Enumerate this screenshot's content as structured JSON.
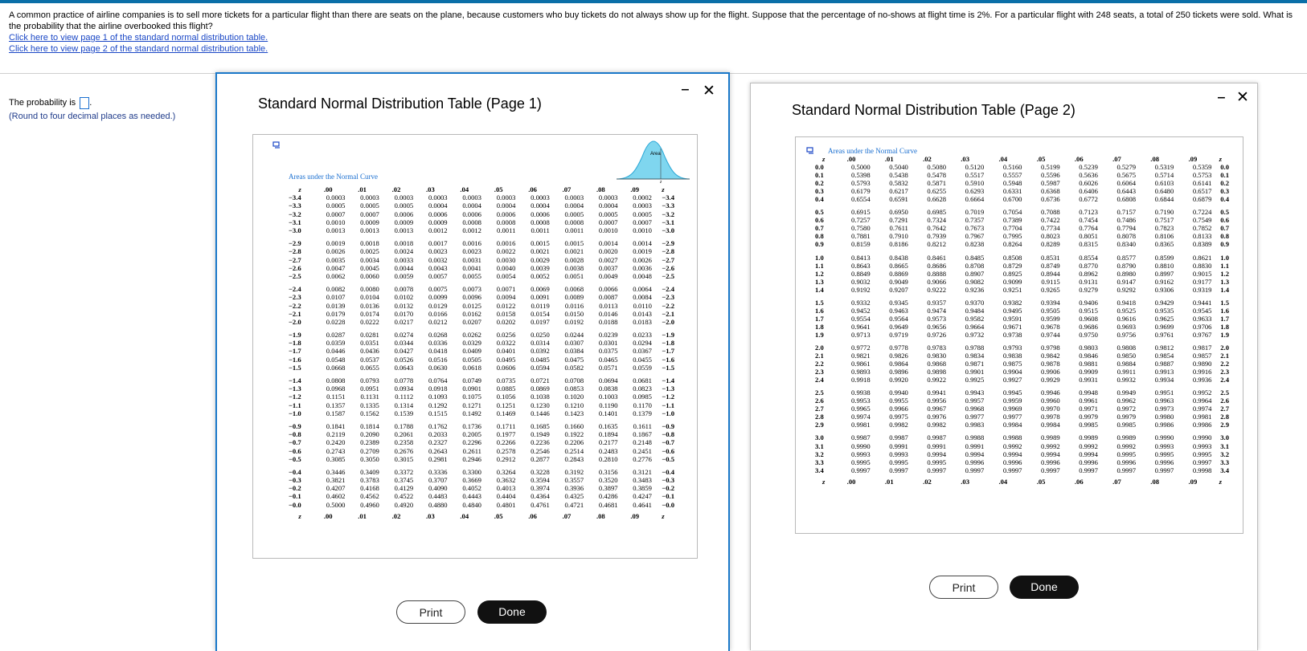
{
  "question": {
    "text": "A common practice of airline companies is to sell more tickets for a particular flight than there are seats on the plane, because customers who buy tickets do not always show up for the flight. Suppose that the percentage of no-shows at flight time is 2%. For a particular flight with 248 seats, a total of 250 tickets were sold. What is the probability that the airline overbooked this flight?",
    "link1": "Click here to view page 1 of the standard normal distribution table.",
    "link2": "Click here to view page 2 of the standard normal distribution table."
  },
  "answer": {
    "prefix": "The probability is",
    "suffix": ".",
    "note": "(Round to four decimal places as needed.)",
    "value": ""
  },
  "modal1": {
    "title": "Standard Normal Distribution Table (Page 1)",
    "minimize": "‒",
    "close": "✕",
    "curve_label": "Areas under the Normal Curve",
    "area_label": "Area",
    "print": "Print",
    "done": "Done",
    "header": [
      "z",
      ".00",
      ".01",
      ".02",
      ".03",
      ".04",
      ".05",
      ".06",
      ".07",
      ".08",
      ".09",
      "z"
    ],
    "rows": [
      [
        "−3.4",
        "0.0003",
        "0.0003",
        "0.0003",
        "0.0003",
        "0.0003",
        "0.0003",
        "0.0003",
        "0.0003",
        "0.0003",
        "0.0002",
        "−3.4"
      ],
      [
        "−3.3",
        "0.0005",
        "0.0005",
        "0.0005",
        "0.0004",
        "0.0004",
        "0.0004",
        "0.0004",
        "0.0004",
        "0.0004",
        "0.0003",
        "−3.3"
      ],
      [
        "−3.2",
        "0.0007",
        "0.0007",
        "0.0006",
        "0.0006",
        "0.0006",
        "0.0006",
        "0.0006",
        "0.0005",
        "0.0005",
        "0.0005",
        "−3.2"
      ],
      [
        "−3.1",
        "0.0010",
        "0.0009",
        "0.0009",
        "0.0009",
        "0.0008",
        "0.0008",
        "0.0008",
        "0.0008",
        "0.0007",
        "0.0007",
        "−3.1"
      ],
      [
        "−3.0",
        "0.0013",
        "0.0013",
        "0.0013",
        "0.0012",
        "0.0012",
        "0.0011",
        "0.0011",
        "0.0011",
        "0.0010",
        "0.0010",
        "−3.0"
      ],
      [
        "−2.9",
        "0.0019",
        "0.0018",
        "0.0018",
        "0.0017",
        "0.0016",
        "0.0016",
        "0.0015",
        "0.0015",
        "0.0014",
        "0.0014",
        "−2.9"
      ],
      [
        "−2.8",
        "0.0026",
        "0.0025",
        "0.0024",
        "0.0023",
        "0.0023",
        "0.0022",
        "0.0021",
        "0.0021",
        "0.0020",
        "0.0019",
        "−2.8"
      ],
      [
        "−2.7",
        "0.0035",
        "0.0034",
        "0.0033",
        "0.0032",
        "0.0031",
        "0.0030",
        "0.0029",
        "0.0028",
        "0.0027",
        "0.0026",
        "−2.7"
      ],
      [
        "−2.6",
        "0.0047",
        "0.0045",
        "0.0044",
        "0.0043",
        "0.0041",
        "0.0040",
        "0.0039",
        "0.0038",
        "0.0037",
        "0.0036",
        "−2.6"
      ],
      [
        "−2.5",
        "0.0062",
        "0.0060",
        "0.0059",
        "0.0057",
        "0.0055",
        "0.0054",
        "0.0052",
        "0.0051",
        "0.0049",
        "0.0048",
        "−2.5"
      ],
      [
        "−2.4",
        "0.0082",
        "0.0080",
        "0.0078",
        "0.0075",
        "0.0073",
        "0.0071",
        "0.0069",
        "0.0068",
        "0.0066",
        "0.0064",
        "−2.4"
      ],
      [
        "−2.3",
        "0.0107",
        "0.0104",
        "0.0102",
        "0.0099",
        "0.0096",
        "0.0094",
        "0.0091",
        "0.0089",
        "0.0087",
        "0.0084",
        "−2.3"
      ],
      [
        "−2.2",
        "0.0139",
        "0.0136",
        "0.0132",
        "0.0129",
        "0.0125",
        "0.0122",
        "0.0119",
        "0.0116",
        "0.0113",
        "0.0110",
        "−2.2"
      ],
      [
        "−2.1",
        "0.0179",
        "0.0174",
        "0.0170",
        "0.0166",
        "0.0162",
        "0.0158",
        "0.0154",
        "0.0150",
        "0.0146",
        "0.0143",
        "−2.1"
      ],
      [
        "−2.0",
        "0.0228",
        "0.0222",
        "0.0217",
        "0.0212",
        "0.0207",
        "0.0202",
        "0.0197",
        "0.0192",
        "0.0188",
        "0.0183",
        "−2.0"
      ],
      [
        "−1.9",
        "0.0287",
        "0.0281",
        "0.0274",
        "0.0268",
        "0.0262",
        "0.0256",
        "0.0250",
        "0.0244",
        "0.0239",
        "0.0233",
        "−1.9"
      ],
      [
        "−1.8",
        "0.0359",
        "0.0351",
        "0.0344",
        "0.0336",
        "0.0329",
        "0.0322",
        "0.0314",
        "0.0307",
        "0.0301",
        "0.0294",
        "−1.8"
      ],
      [
        "−1.7",
        "0.0446",
        "0.0436",
        "0.0427",
        "0.0418",
        "0.0409",
        "0.0401",
        "0.0392",
        "0.0384",
        "0.0375",
        "0.0367",
        "−1.7"
      ],
      [
        "−1.6",
        "0.0548",
        "0.0537",
        "0.0526",
        "0.0516",
        "0.0505",
        "0.0495",
        "0.0485",
        "0.0475",
        "0.0465",
        "0.0455",
        "−1.6"
      ],
      [
        "−1.5",
        "0.0668",
        "0.0655",
        "0.0643",
        "0.0630",
        "0.0618",
        "0.0606",
        "0.0594",
        "0.0582",
        "0.0571",
        "0.0559",
        "−1.5"
      ],
      [
        "−1.4",
        "0.0808",
        "0.0793",
        "0.0778",
        "0.0764",
        "0.0749",
        "0.0735",
        "0.0721",
        "0.0708",
        "0.0694",
        "0.0681",
        "−1.4"
      ],
      [
        "−1.3",
        "0.0968",
        "0.0951",
        "0.0934",
        "0.0918",
        "0.0901",
        "0.0885",
        "0.0869",
        "0.0853",
        "0.0838",
        "0.0823",
        "−1.3"
      ],
      [
        "−1.2",
        "0.1151",
        "0.1131",
        "0.1112",
        "0.1093",
        "0.1075",
        "0.1056",
        "0.1038",
        "0.1020",
        "0.1003",
        "0.0985",
        "−1.2"
      ],
      [
        "−1.1",
        "0.1357",
        "0.1335",
        "0.1314",
        "0.1292",
        "0.1271",
        "0.1251",
        "0.1230",
        "0.1210",
        "0.1190",
        "0.1170",
        "−1.1"
      ],
      [
        "−1.0",
        "0.1587",
        "0.1562",
        "0.1539",
        "0.1515",
        "0.1492",
        "0.1469",
        "0.1446",
        "0.1423",
        "0.1401",
        "0.1379",
        "−1.0"
      ],
      [
        "−0.9",
        "0.1841",
        "0.1814",
        "0.1788",
        "0.1762",
        "0.1736",
        "0.1711",
        "0.1685",
        "0.1660",
        "0.1635",
        "0.1611",
        "−0.9"
      ],
      [
        "−0.8",
        "0.2119",
        "0.2090",
        "0.2061",
        "0.2033",
        "0.2005",
        "0.1977",
        "0.1949",
        "0.1922",
        "0.1894",
        "0.1867",
        "−0.8"
      ],
      [
        "−0.7",
        "0.2420",
        "0.2389",
        "0.2358",
        "0.2327",
        "0.2296",
        "0.2266",
        "0.2236",
        "0.2206",
        "0.2177",
        "0.2148",
        "−0.7"
      ],
      [
        "−0.6",
        "0.2743",
        "0.2709",
        "0.2676",
        "0.2643",
        "0.2611",
        "0.2578",
        "0.2546",
        "0.2514",
        "0.2483",
        "0.2451",
        "−0.6"
      ],
      [
        "−0.5",
        "0.3085",
        "0.3050",
        "0.3015",
        "0.2981",
        "0.2946",
        "0.2912",
        "0.2877",
        "0.2843",
        "0.2810",
        "0.2776",
        "−0.5"
      ],
      [
        "−0.4",
        "0.3446",
        "0.3409",
        "0.3372",
        "0.3336",
        "0.3300",
        "0.3264",
        "0.3228",
        "0.3192",
        "0.3156",
        "0.3121",
        "−0.4"
      ],
      [
        "−0.3",
        "0.3821",
        "0.3783",
        "0.3745",
        "0.3707",
        "0.3669",
        "0.3632",
        "0.3594",
        "0.3557",
        "0.3520",
        "0.3483",
        "−0.3"
      ],
      [
        "−0.2",
        "0.4207",
        "0.4168",
        "0.4129",
        "0.4090",
        "0.4052",
        "0.4013",
        "0.3974",
        "0.3936",
        "0.3897",
        "0.3859",
        "−0.2"
      ],
      [
        "−0.1",
        "0.4602",
        "0.4562",
        "0.4522",
        "0.4483",
        "0.4443",
        "0.4404",
        "0.4364",
        "0.4325",
        "0.4286",
        "0.4247",
        "−0.1"
      ],
      [
        "−0.0",
        "0.5000",
        "0.4960",
        "0.4920",
        "0.4880",
        "0.4840",
        "0.4801",
        "0.4761",
        "0.4721",
        "0.4681",
        "0.4641",
        "−0.0"
      ]
    ]
  },
  "modal2": {
    "title": "Standard Normal Distribution Table (Page 2)",
    "minimize": "‒",
    "close": "✕",
    "curve_label": "Areas under the Normal Curve",
    "print": "Print",
    "done": "Done",
    "header": [
      "z",
      ".00",
      ".01",
      ".02",
      ".03",
      ".04",
      ".05",
      ".06",
      ".07",
      ".08",
      ".09",
      "z"
    ],
    "rows": [
      [
        "0.0",
        "0.5000",
        "0.5040",
        "0.5080",
        "0.5120",
        "0.5160",
        "0.5199",
        "0.5239",
        "0.5279",
        "0.5319",
        "0.5359",
        "0.0"
      ],
      [
        "0.1",
        "0.5398",
        "0.5438",
        "0.5478",
        "0.5517",
        "0.5557",
        "0.5596",
        "0.5636",
        "0.5675",
        "0.5714",
        "0.5753",
        "0.1"
      ],
      [
        "0.2",
        "0.5793",
        "0.5832",
        "0.5871",
        "0.5910",
        "0.5948",
        "0.5987",
        "0.6026",
        "0.6064",
        "0.6103",
        "0.6141",
        "0.2"
      ],
      [
        "0.3",
        "0.6179",
        "0.6217",
        "0.6255",
        "0.6293",
        "0.6331",
        "0.6368",
        "0.6406",
        "0.6443",
        "0.6480",
        "0.6517",
        "0.3"
      ],
      [
        "0.4",
        "0.6554",
        "0.6591",
        "0.6628",
        "0.6664",
        "0.6700",
        "0.6736",
        "0.6772",
        "0.6808",
        "0.6844",
        "0.6879",
        "0.4"
      ],
      [
        "0.5",
        "0.6915",
        "0.6950",
        "0.6985",
        "0.7019",
        "0.7054",
        "0.7088",
        "0.7123",
        "0.7157",
        "0.7190",
        "0.7224",
        "0.5"
      ],
      [
        "0.6",
        "0.7257",
        "0.7291",
        "0.7324",
        "0.7357",
        "0.7389",
        "0.7422",
        "0.7454",
        "0.7486",
        "0.7517",
        "0.7549",
        "0.6"
      ],
      [
        "0.7",
        "0.7580",
        "0.7611",
        "0.7642",
        "0.7673",
        "0.7704",
        "0.7734",
        "0.7764",
        "0.7794",
        "0.7823",
        "0.7852",
        "0.7"
      ],
      [
        "0.8",
        "0.7881",
        "0.7910",
        "0.7939",
        "0.7967",
        "0.7995",
        "0.8023",
        "0.8051",
        "0.8078",
        "0.8106",
        "0.8133",
        "0.8"
      ],
      [
        "0.9",
        "0.8159",
        "0.8186",
        "0.8212",
        "0.8238",
        "0.8264",
        "0.8289",
        "0.8315",
        "0.8340",
        "0.8365",
        "0.8389",
        "0.9"
      ],
      [
        "1.0",
        "0.8413",
        "0.8438",
        "0.8461",
        "0.8485",
        "0.8508",
        "0.8531",
        "0.8554",
        "0.8577",
        "0.8599",
        "0.8621",
        "1.0"
      ],
      [
        "1.1",
        "0.8643",
        "0.8665",
        "0.8686",
        "0.8708",
        "0.8729",
        "0.8749",
        "0.8770",
        "0.8790",
        "0.8810",
        "0.8830",
        "1.1"
      ],
      [
        "1.2",
        "0.8849",
        "0.8869",
        "0.8888",
        "0.8907",
        "0.8925",
        "0.8944",
        "0.8962",
        "0.8980",
        "0.8997",
        "0.9015",
        "1.2"
      ],
      [
        "1.3",
        "0.9032",
        "0.9049",
        "0.9066",
        "0.9082",
        "0.9099",
        "0.9115",
        "0.9131",
        "0.9147",
        "0.9162",
        "0.9177",
        "1.3"
      ],
      [
        "1.4",
        "0.9192",
        "0.9207",
        "0.9222",
        "0.9236",
        "0.9251",
        "0.9265",
        "0.9279",
        "0.9292",
        "0.9306",
        "0.9319",
        "1.4"
      ],
      [
        "1.5",
        "0.9332",
        "0.9345",
        "0.9357",
        "0.9370",
        "0.9382",
        "0.9394",
        "0.9406",
        "0.9418",
        "0.9429",
        "0.9441",
        "1.5"
      ],
      [
        "1.6",
        "0.9452",
        "0.9463",
        "0.9474",
        "0.9484",
        "0.9495",
        "0.9505",
        "0.9515",
        "0.9525",
        "0.9535",
        "0.9545",
        "1.6"
      ],
      [
        "1.7",
        "0.9554",
        "0.9564",
        "0.9573",
        "0.9582",
        "0.9591",
        "0.9599",
        "0.9608",
        "0.9616",
        "0.9625",
        "0.9633",
        "1.7"
      ],
      [
        "1.8",
        "0.9641",
        "0.9649",
        "0.9656",
        "0.9664",
        "0.9671",
        "0.9678",
        "0.9686",
        "0.9693",
        "0.9699",
        "0.9706",
        "1.8"
      ],
      [
        "1.9",
        "0.9713",
        "0.9719",
        "0.9726",
        "0.9732",
        "0.9738",
        "0.9744",
        "0.9750",
        "0.9756",
        "0.9761",
        "0.9767",
        "1.9"
      ],
      [
        "2.0",
        "0.9772",
        "0.9778",
        "0.9783",
        "0.9788",
        "0.9793",
        "0.9798",
        "0.9803",
        "0.9808",
        "0.9812",
        "0.9817",
        "2.0"
      ],
      [
        "2.1",
        "0.9821",
        "0.9826",
        "0.9830",
        "0.9834",
        "0.9838",
        "0.9842",
        "0.9846",
        "0.9850",
        "0.9854",
        "0.9857",
        "2.1"
      ],
      [
        "2.2",
        "0.9861",
        "0.9864",
        "0.9868",
        "0.9871",
        "0.9875",
        "0.9878",
        "0.9881",
        "0.9884",
        "0.9887",
        "0.9890",
        "2.2"
      ],
      [
        "2.3",
        "0.9893",
        "0.9896",
        "0.9898",
        "0.9901",
        "0.9904",
        "0.9906",
        "0.9909",
        "0.9911",
        "0.9913",
        "0.9916",
        "2.3"
      ],
      [
        "2.4",
        "0.9918",
        "0.9920",
        "0.9922",
        "0.9925",
        "0.9927",
        "0.9929",
        "0.9931",
        "0.9932",
        "0.9934",
        "0.9936",
        "2.4"
      ],
      [
        "2.5",
        "0.9938",
        "0.9940",
        "0.9941",
        "0.9943",
        "0.9945",
        "0.9946",
        "0.9948",
        "0.9949",
        "0.9951",
        "0.9952",
        "2.5"
      ],
      [
        "2.6",
        "0.9953",
        "0.9955",
        "0.9956",
        "0.9957",
        "0.9959",
        "0.9960",
        "0.9961",
        "0.9962",
        "0.9963",
        "0.9964",
        "2.6"
      ],
      [
        "2.7",
        "0.9965",
        "0.9966",
        "0.9967",
        "0.9968",
        "0.9969",
        "0.9970",
        "0.9971",
        "0.9972",
        "0.9973",
        "0.9974",
        "2.7"
      ],
      [
        "2.8",
        "0.9974",
        "0.9975",
        "0.9976",
        "0.9977",
        "0.9977",
        "0.9978",
        "0.9979",
        "0.9979",
        "0.9980",
        "0.9981",
        "2.8"
      ],
      [
        "2.9",
        "0.9981",
        "0.9982",
        "0.9982",
        "0.9983",
        "0.9984",
        "0.9984",
        "0.9985",
        "0.9985",
        "0.9986",
        "0.9986",
        "2.9"
      ],
      [
        "3.0",
        "0.9987",
        "0.9987",
        "0.9987",
        "0.9988",
        "0.9988",
        "0.9989",
        "0.9989",
        "0.9989",
        "0.9990",
        "0.9990",
        "3.0"
      ],
      [
        "3.1",
        "0.9990",
        "0.9991",
        "0.9991",
        "0.9991",
        "0.9992",
        "0.9992",
        "0.9992",
        "0.9992",
        "0.9993",
        "0.9993",
        "3.1"
      ],
      [
        "3.2",
        "0.9993",
        "0.9993",
        "0.9994",
        "0.9994",
        "0.9994",
        "0.9994",
        "0.9994",
        "0.9995",
        "0.9995",
        "0.9995",
        "3.2"
      ],
      [
        "3.3",
        "0.9995",
        "0.9995",
        "0.9995",
        "0.9996",
        "0.9996",
        "0.9996",
        "0.9996",
        "0.9996",
        "0.9996",
        "0.9997",
        "3.3"
      ],
      [
        "3.4",
        "0.9997",
        "0.9997",
        "0.9997",
        "0.9997",
        "0.9997",
        "0.9997",
        "0.9997",
        "0.9997",
        "0.9997",
        "0.9998",
        "3.4"
      ]
    ]
  },
  "colors": {
    "accent": "#1a78c9",
    "link": "#1a47c6",
    "curve_fill": "#7fd6ef",
    "done_bg": "#111111"
  }
}
